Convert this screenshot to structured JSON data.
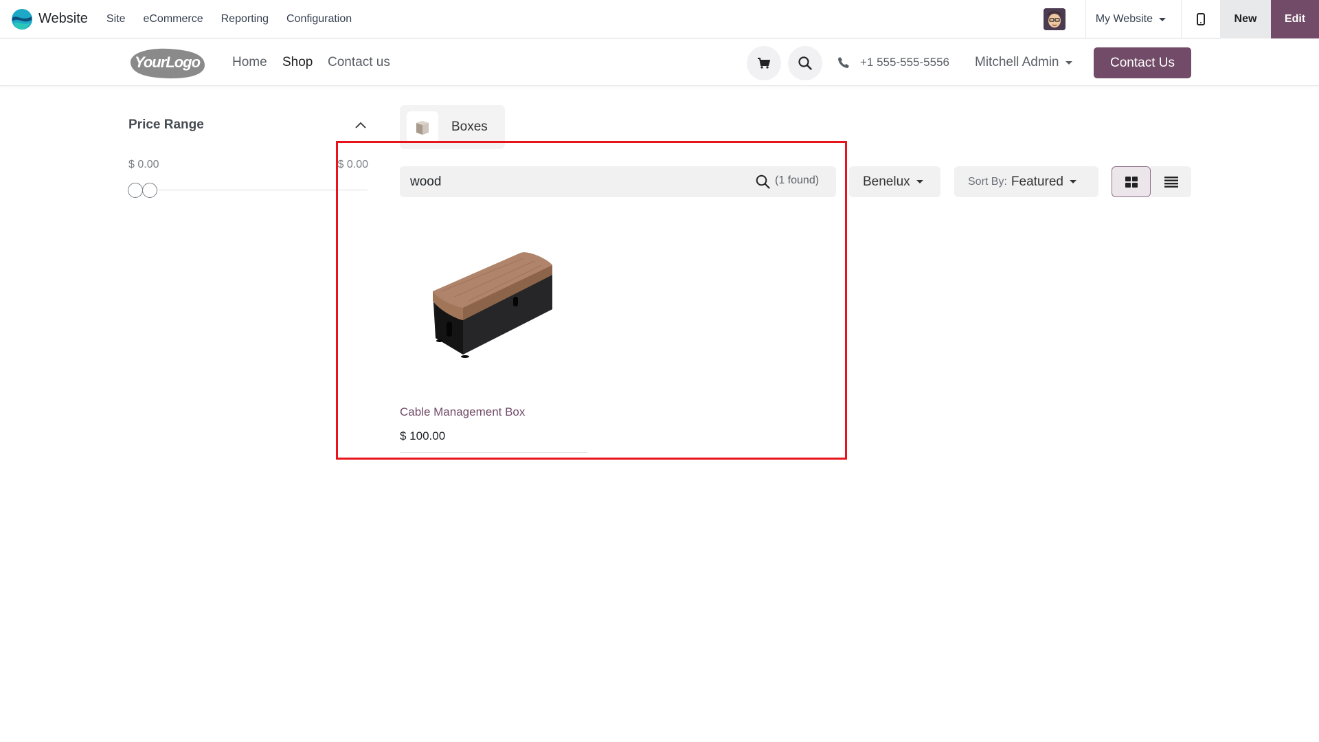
{
  "admin_bar": {
    "app_name": "Website",
    "menu": [
      "Site",
      "eCommerce",
      "Reporting",
      "Configuration"
    ],
    "website_selector": "My Website",
    "new_label": "New",
    "edit_label": "Edit",
    "accent_color": "#714b67"
  },
  "header": {
    "logo_text": "YourLogo",
    "nav": [
      "Home",
      "Shop",
      "Contact us"
    ],
    "active_nav": "Shop",
    "phone": "+1 555-555-5556",
    "user": "Mitchell Admin",
    "cta_label": "Contact Us"
  },
  "sidebar": {
    "price_range": {
      "title": "Price Range",
      "min_label": "$ 0.00",
      "max_label": "$ 0.00"
    }
  },
  "category": {
    "label": "Boxes",
    "icon": "box-thumbnail"
  },
  "search": {
    "value": "wood",
    "results_count": "(1 found)"
  },
  "pricelist": {
    "selected": "Benelux"
  },
  "sort": {
    "prefix": "Sort By:",
    "selected": "Featured"
  },
  "view_mode": "grid",
  "products": [
    {
      "name": "Cable Management Box",
      "price": "$ 100.00",
      "image": "black box with wooden lid"
    }
  ],
  "annotation": {
    "highlight_color": "#e8141c"
  }
}
